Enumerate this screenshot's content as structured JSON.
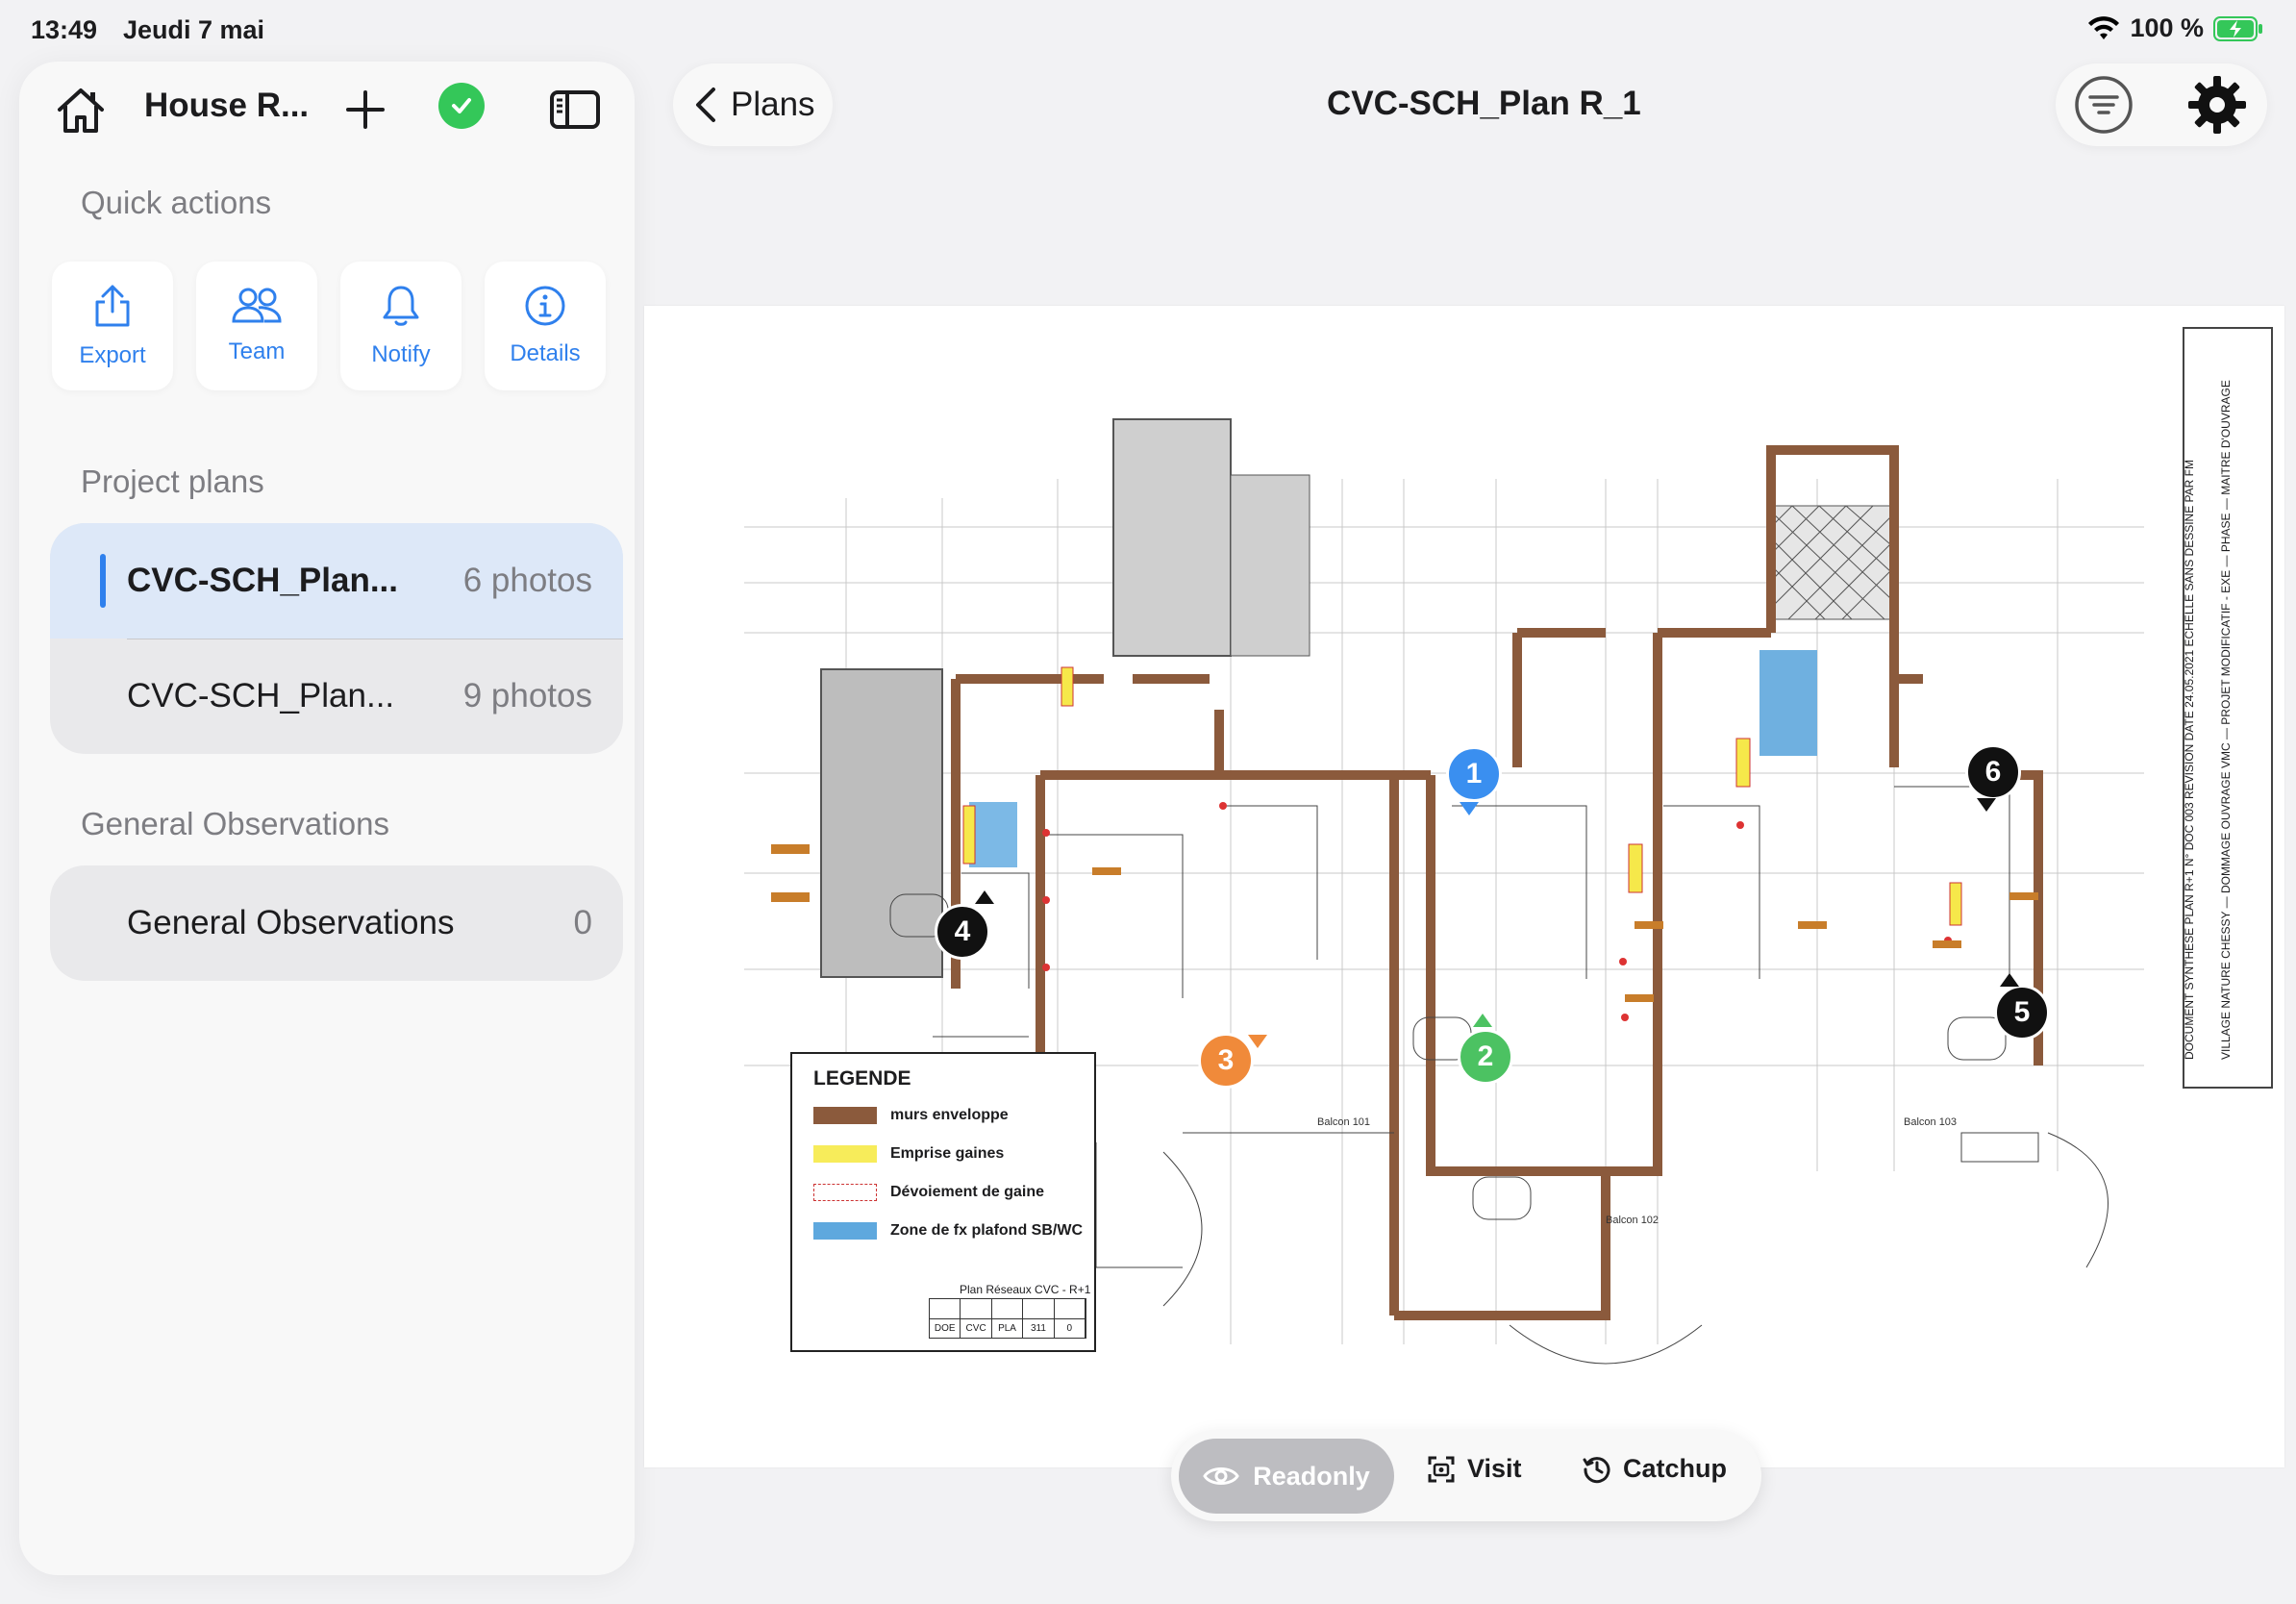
{
  "status_bar": {
    "time": "13:49",
    "date": "Jeudi 7 mai",
    "battery": "100 %"
  },
  "sidebar": {
    "project_name": "House R...",
    "quick_actions_title": "Quick actions",
    "quick_actions": [
      {
        "label": "Export",
        "icon": "share-icon"
      },
      {
        "label": "Team",
        "icon": "team-icon"
      },
      {
        "label": "Notify",
        "icon": "bell-icon"
      },
      {
        "label": "Details",
        "icon": "info-icon"
      }
    ],
    "project_plans_title": "Project plans",
    "plans": [
      {
        "name": "CVC-SCH_Plan...",
        "count": "6 photos",
        "selected": true
      },
      {
        "name": "CVC-SCH_Plan...",
        "count": "9 photos",
        "selected": false
      }
    ],
    "general_observations_title": "General Observations",
    "observations": {
      "name": "General Observations",
      "count": "0"
    }
  },
  "header": {
    "back_label": "Plans",
    "title": "CVC-SCH_Plan R_1"
  },
  "plan": {
    "legend": {
      "title": "LEGENDE",
      "items": [
        {
          "label": "murs enveloppe",
          "color": "#8b5a3c"
        },
        {
          "label": "Emprise gaines",
          "color": "#f7ec5a"
        },
        {
          "label": "Dévoiement de gaine",
          "color": "#ffffff"
        },
        {
          "label": "Zone de fx plafond SB/WC",
          "color": "#5ea8de"
        }
      ],
      "subtitle": "Plan Réseaux CVC - R+1",
      "table_values": [
        "DOE",
        "CVC",
        "PLA",
        "311",
        "0"
      ]
    },
    "title_block_text": "DOCUMENT SYNTHESE PLAN R+1   N° DOC 003   REVISION   DATE 24.05.2021   ECHELLE SANS   DESSINE PAR FM",
    "title_block_text2": "VILLAGE NATURE CHESSY — DOMMAGE OUVRAGE VMC — PROJET MODIFICATIF - EXE — PHASE — MAITRE D'OUVRAGE",
    "balcony_labels": [
      "Balcon 101",
      "Balcon 102",
      "Balcon 103"
    ],
    "pins": [
      {
        "number": "1",
        "color": "#3a8ff0"
      },
      {
        "number": "2",
        "color": "#4cc262"
      },
      {
        "number": "3",
        "color": "#f08a3a"
      },
      {
        "number": "4",
        "color": "#111111"
      },
      {
        "number": "5",
        "color": "#111111"
      },
      {
        "number": "6",
        "color": "#111111"
      }
    ]
  },
  "bottom_bar": {
    "readonly_label": "Readonly",
    "visit_label": "Visit",
    "catchup_label": "Catchup"
  },
  "colors": {
    "accent": "#2f80ed",
    "success": "#34c759",
    "wall": "#8b5a3c"
  }
}
